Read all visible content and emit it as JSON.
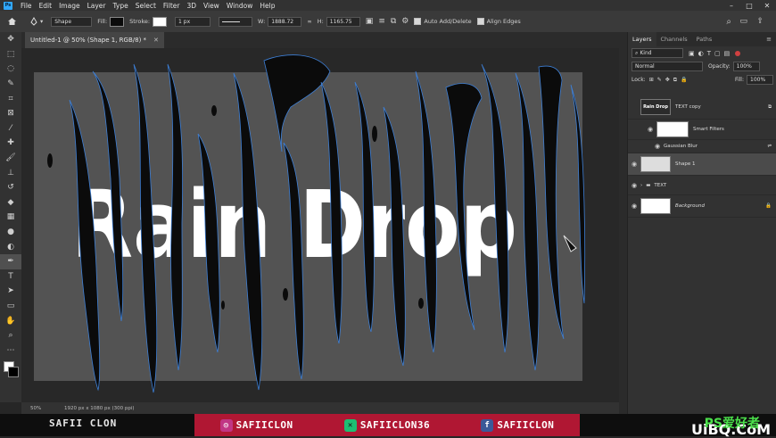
{
  "menubar": {
    "logo": "Ps",
    "items": [
      "File",
      "Edit",
      "Image",
      "Layer",
      "Type",
      "Select",
      "Filter",
      "3D",
      "View",
      "Window",
      "Help"
    ],
    "window_controls": [
      "–",
      "□",
      "✕"
    ]
  },
  "options": {
    "mode": "Shape",
    "fill_label": "Fill:",
    "stroke_label": "Stroke:",
    "stroke_size": "1 px",
    "width_label": "W:",
    "width_value": "1888.72",
    "height_label": "H:",
    "height_value": "1165.75",
    "auto_add_label": "Auto Add/Delete",
    "align_edges_label": "Align Edges"
  },
  "document": {
    "tab_title": "Untitled-1 @ 50% (Shape 1, RGB/8) *",
    "canvas_text": "Rain Drop",
    "zoom": "50%",
    "doc_info": "1920 px x 1080 px (300 ppi)"
  },
  "colors": {
    "canvas": "#535353",
    "drip": "#0b0b0b",
    "path": "#3d7fd6",
    "accent_red": "#b01733"
  },
  "panel": {
    "tabs": [
      "Layers",
      "Channels",
      "Paths"
    ],
    "filter_kind": "Kind",
    "blend_mode": "Normal",
    "opacity_label": "Opacity:",
    "opacity_value": "100%",
    "lock_label": "Lock:",
    "fill_label": "Fill:",
    "fill_value": "100%",
    "layers": [
      {
        "name": "TEXT copy",
        "thumb_text": "Rain Drop"
      },
      {
        "name": "Smart Filters"
      },
      {
        "name": "Gaussian Blur"
      },
      {
        "name": "Shape 1"
      },
      {
        "name": "TEXT"
      },
      {
        "name": "Background"
      }
    ]
  },
  "footer": {
    "left_name": "SAFII CLON",
    "instagram": "SAFIICLON",
    "fiverr": "SAFIICLON36",
    "facebook": "SAFIICLON",
    "watermark": "UiBQ.CoM",
    "watermark_cn": "PS爱好者"
  }
}
